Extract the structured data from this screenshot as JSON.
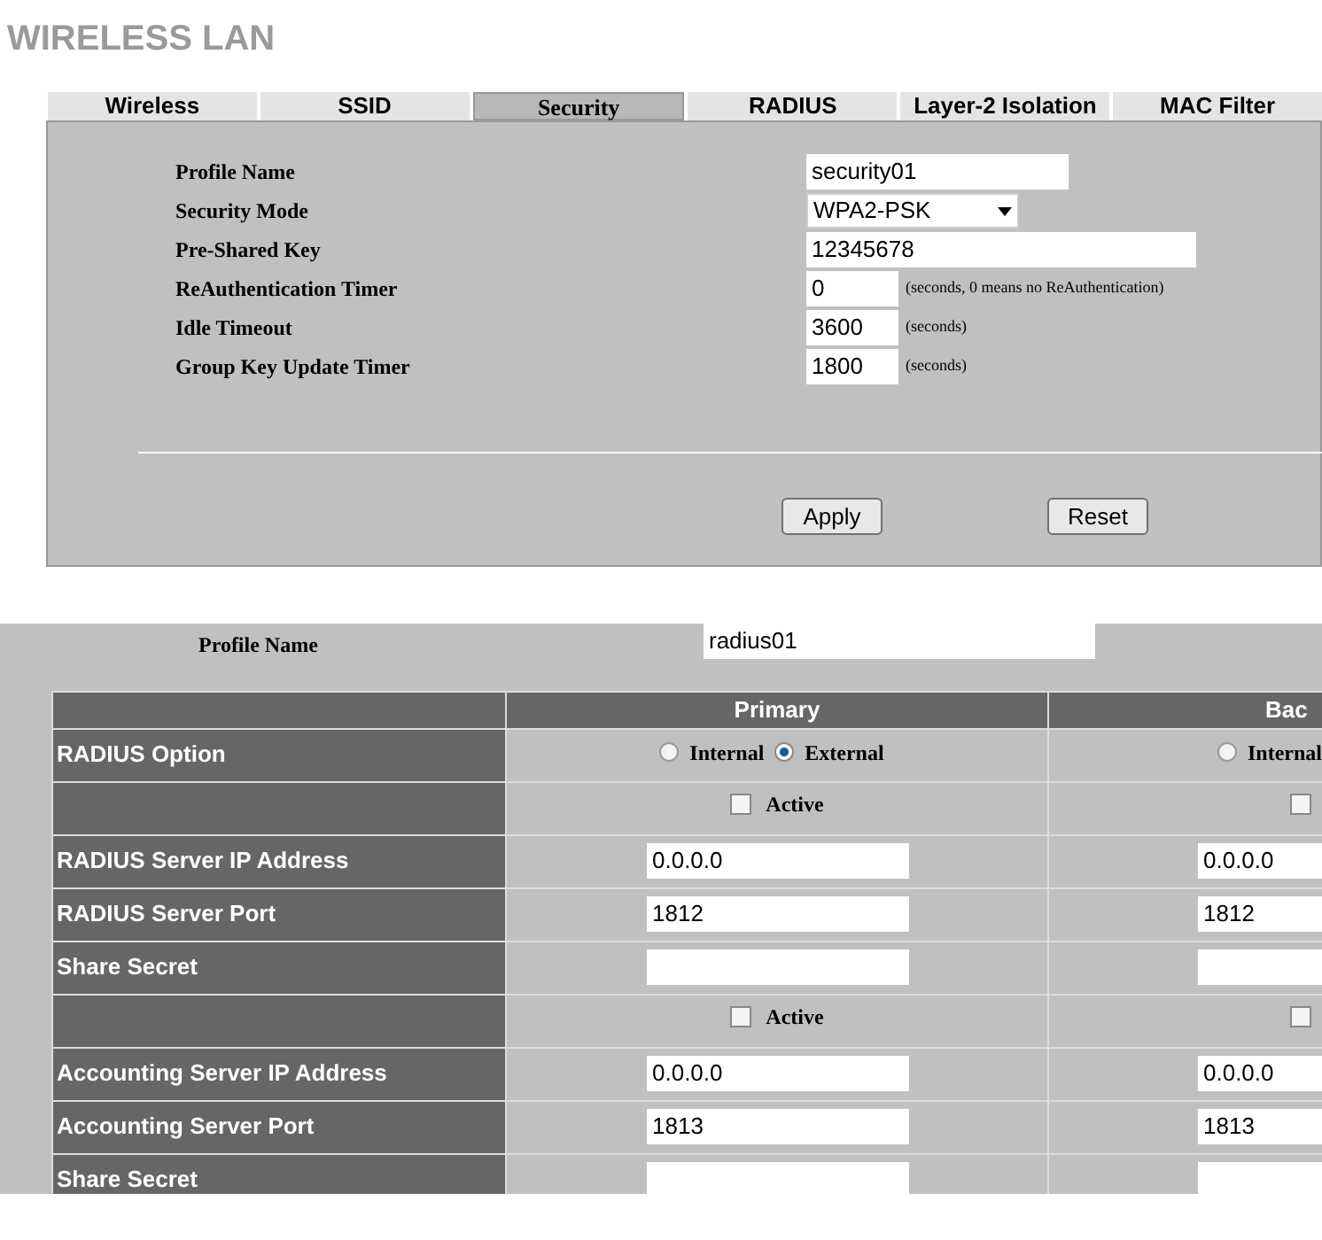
{
  "page_title": "WIRELESS LAN",
  "tabs": [
    {
      "label": "Wireless",
      "selected": false
    },
    {
      "label": "SSID",
      "selected": false
    },
    {
      "label": "Security",
      "selected": true
    },
    {
      "label": "RADIUS",
      "selected": false
    },
    {
      "label": "Layer-2 Isolation",
      "selected": false
    },
    {
      "label": "MAC Filter",
      "selected": false
    }
  ],
  "security": {
    "fields": [
      {
        "label": "Profile Name",
        "kind": "name",
        "value": "security01"
      },
      {
        "label": "Security Mode",
        "kind": "select",
        "value": "WPA2-PSK"
      },
      {
        "label": "Pre-Shared Key",
        "kind": "key",
        "value": "12345678"
      },
      {
        "label": "ReAuthentication Timer",
        "kind": "timer",
        "value": "0",
        "hint": "(seconds, 0 means no ReAuthentication)"
      },
      {
        "label": "Idle Timeout",
        "kind": "timer",
        "value": "3600",
        "hint": "(seconds)"
      },
      {
        "label": "Group Key Update Timer",
        "kind": "timer",
        "value": "1800",
        "hint": "(seconds)"
      }
    ],
    "buttons": [
      "Apply",
      "Reset"
    ]
  },
  "radius": {
    "profile_label": "Profile Name",
    "profile_value": "radius01",
    "columns": [
      "Primary",
      "Bac"
    ],
    "rows": [
      {
        "kind": "radio",
        "label": "RADIUS Option",
        "primary": [
          {
            "label": "Internal",
            "selected": false
          },
          {
            "label": "External",
            "selected": true
          }
        ],
        "backup": [
          {
            "label": "Internal",
            "selected": false
          }
        ]
      },
      {
        "kind": "checkbox",
        "primary": {
          "label": "Active",
          "checked": false
        },
        "backup": {
          "checked": false
        }
      },
      {
        "kind": "input",
        "label": "RADIUS Server IP Address",
        "primary": "0.0.0.0",
        "backup": "0.0.0.0"
      },
      {
        "kind": "input",
        "label": "RADIUS Server Port",
        "primary": "1812",
        "backup": "1812"
      },
      {
        "kind": "input",
        "label": "Share Secret"
      },
      {
        "kind": "checkbox",
        "primary": {
          "label": "Active",
          "checked": false
        },
        "backup": {
          "checked": false
        }
      },
      {
        "kind": "input",
        "label": "Accounting Server IP Address",
        "primary": "0.0.0.0",
        "backup": "0.0.0.0"
      },
      {
        "kind": "input",
        "label": "Accounting Server Port",
        "primary": "1813",
        "backup": "1813"
      },
      {
        "kind": "input",
        "label": "Share Secret"
      }
    ]
  }
}
